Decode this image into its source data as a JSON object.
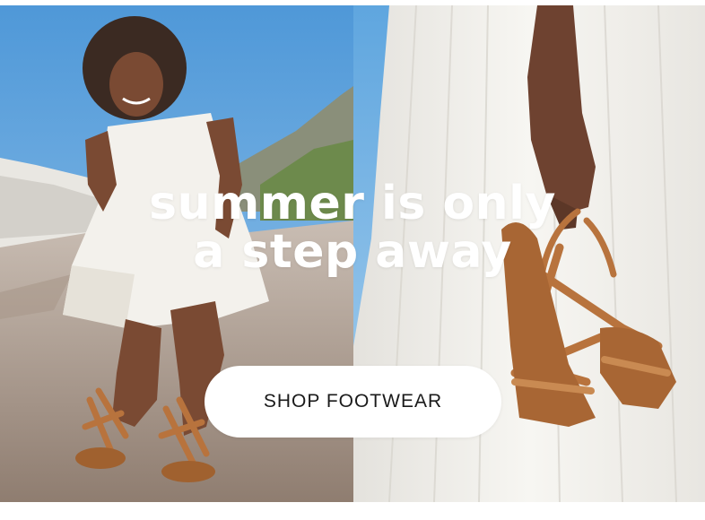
{
  "headline": {
    "line1": "summer is only",
    "line2": "a step away"
  },
  "cta": {
    "label": "SHOP FOOTWEAR"
  },
  "colors": {
    "sky": "#5ea4dd",
    "dress": "#f3f1ec",
    "sandal": "#b8733d",
    "skin": "#7a4a33",
    "rock": "#b9a89a"
  }
}
